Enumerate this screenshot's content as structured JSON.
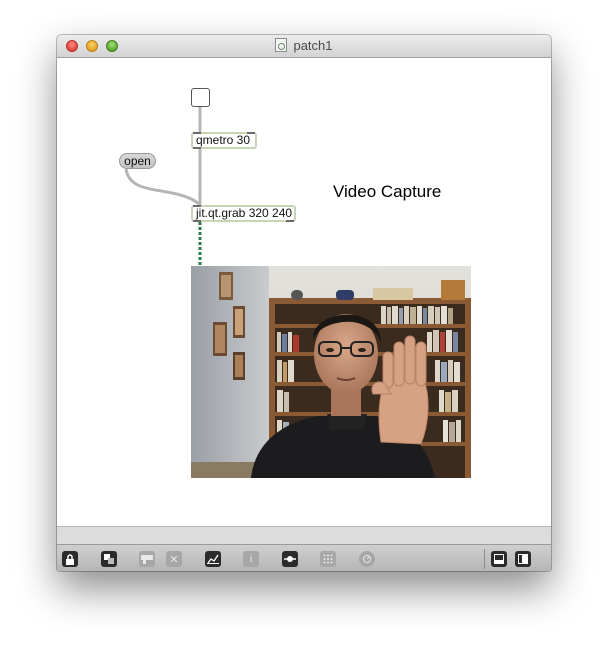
{
  "window": {
    "title": "patch1"
  },
  "patch": {
    "qmetro_text": "qmetro 30",
    "grab_text": "jit.qt.grab 320 240",
    "open_message": "open",
    "comment_text": "Video Capture"
  },
  "toolbar": {
    "buttons": [
      "lock-icon",
      "presentation-icon",
      "comments-icon",
      "clear-icon",
      "grid-snap-icon",
      "inspector-icon",
      "connect-icon",
      "grid-icon",
      "dial-icon",
      "split-bottom-icon",
      "split-right-icon"
    ]
  },
  "colors": {
    "object_border": "#c7d4b6",
    "patchcord": "#b5b5b5",
    "signal_cord": "#2e7d46",
    "toolbar": "#c4c4c4"
  }
}
